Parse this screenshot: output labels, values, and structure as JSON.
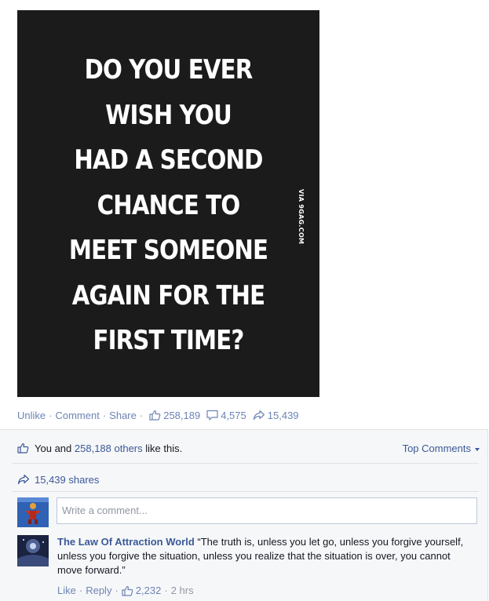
{
  "post": {
    "image_lines": [
      "DO YOU EVER",
      "WISH YOU",
      "HAD A SECOND",
      "CHANCE TO",
      "MEET SOMEONE",
      "AGAIN FOR THE",
      "FIRST TIME?"
    ],
    "watermark": "VIA 9GAG.COM"
  },
  "actions": {
    "unlike": "Unlike",
    "comment": "Comment",
    "share": "Share",
    "like_count": "258,189",
    "comment_count": "4,575",
    "share_count": "15,439"
  },
  "likes_summary": {
    "you": "You",
    "and": "and",
    "others": "258,188 others",
    "suffix": "like this."
  },
  "sort_label": "Top Comments",
  "shares_label": "15,439 shares",
  "comment_input": {
    "placeholder": "Write a comment..."
  },
  "comment": {
    "author": "The Law Of Attraction World",
    "text": "“The truth is, unless you let go, unless you forgive yourself, unless you forgive the situation, unless you realize that the situation is over, you cannot move forward.”",
    "like": "Like",
    "reply": "Reply",
    "likes": "2,232",
    "time": "2 hrs"
  },
  "colors": {
    "link": "#6d84b4",
    "brand": "#3b5998",
    "panel": "#f6f7f8"
  },
  "icons": [
    "thumbs-up-icon",
    "comment-bubble-icon",
    "share-arrow-icon",
    "caret-down-icon"
  ]
}
